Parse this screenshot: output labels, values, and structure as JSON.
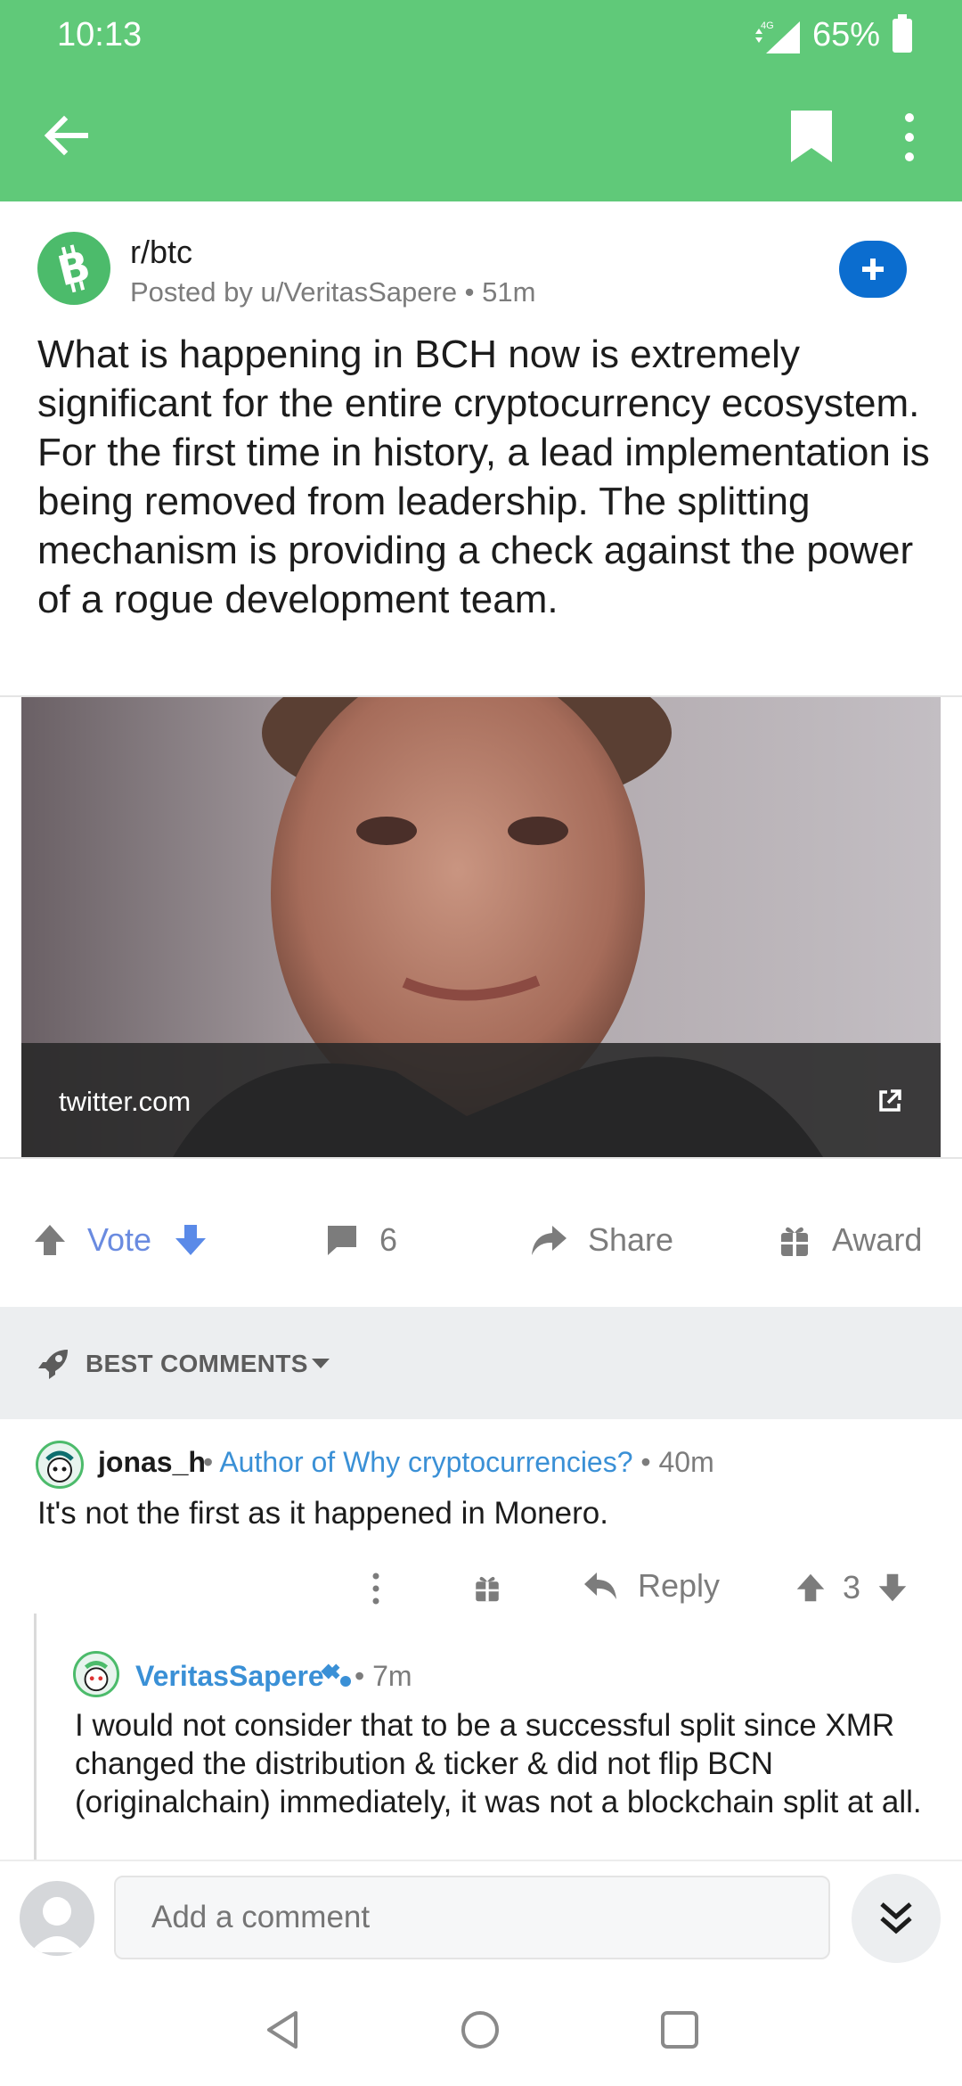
{
  "status_bar": {
    "time": "10:13",
    "network": "4G",
    "battery": "65%"
  },
  "post": {
    "subreddit": "r/btc",
    "posted_by": "Posted by u/VeritasSapere • 51m",
    "title": "What is happening in BCH now is extremely significant for the entire cryptocurrency ecosystem. For the first time in history, a lead implementation is being removed from leadership. The splitting mechanism is providing a check against the power of a rogue development team.",
    "link_domain": "twitter.com"
  },
  "actions": {
    "vote_label": "Vote",
    "comment_count": "6",
    "share_label": "Share",
    "award_label": "Award"
  },
  "sort": {
    "label": "BEST COMMENTS"
  },
  "comments": [
    {
      "author": "jonas_h",
      "flair": "Author of Why cryptocurrencies?",
      "age": "• 40m",
      "body": "It's not the first as it happened in Monero.",
      "reply_label": "Reply",
      "score": "3"
    },
    {
      "author": "VeritasSapere",
      "age": "• 7m",
      "body": "I would not consider that to be a successful split since XMR changed the distribution & ticker & did not flip BCN (originalchain) immediately, it was not a blockchain split at all."
    }
  ],
  "composer": {
    "placeholder": "Add a comment"
  },
  "colors": {
    "header": "#60c979",
    "accent_blue": "#0b6dcf",
    "flair_blue": "#3a90d6",
    "vote_blue": "#6a8be0"
  }
}
